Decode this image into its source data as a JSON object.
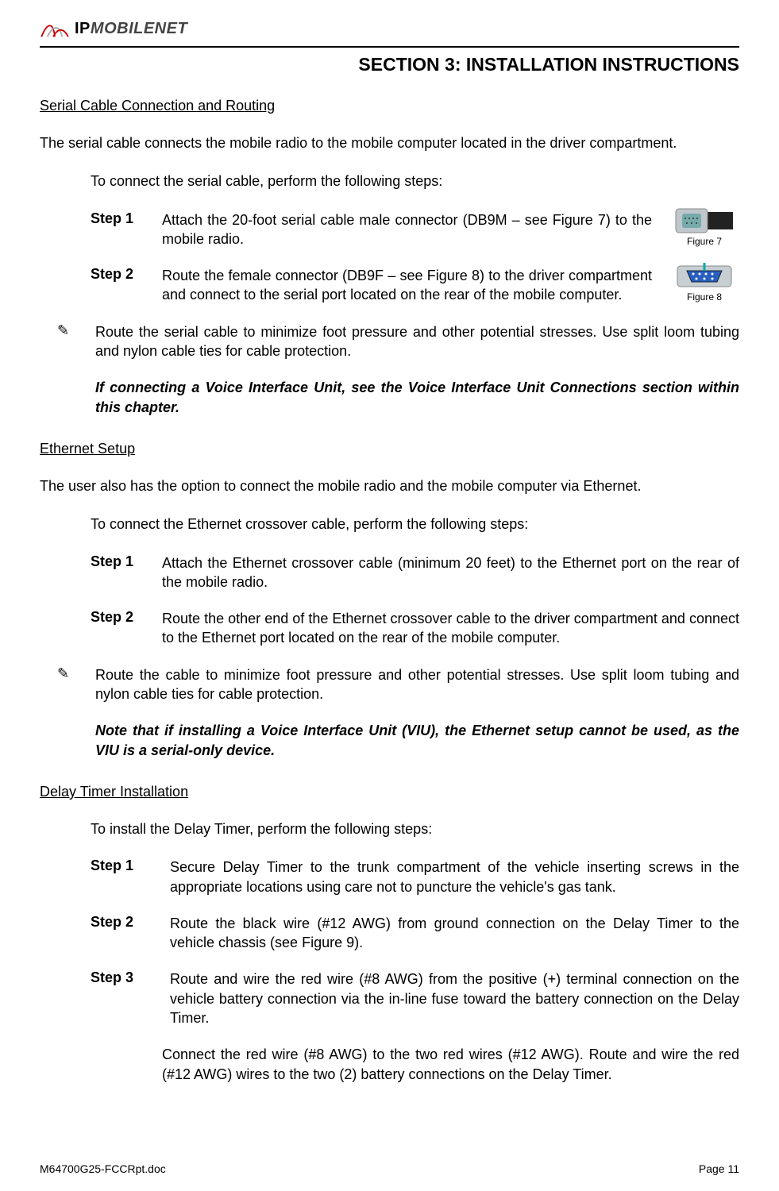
{
  "logo": {
    "brand_ip": "IP",
    "brand_rest": "MOBILENET"
  },
  "section_header": "SECTION 3: INSTALLATION INSTRUCTIONS",
  "serial": {
    "heading": "Serial Cable Connection and Routing",
    "intro": "The serial cable connects the mobile radio to the mobile computer located in the driver compartment.",
    "lead": "To connect the serial cable, perform the following steps:",
    "step1_label": "Step 1",
    "step1_text": "Attach the 20-foot serial cable male connector (DB9M – see Figure 7) to the mobile radio.",
    "step2_label": "Step 2",
    "step2_text": "Route the female connector (DB9F – see Figure 8) to the driver compartment and connect to the serial port located on the rear of the mobile computer.",
    "note_icon": "✎",
    "note_text": "Route the serial cable to minimize foot pressure and other potential stresses.  Use split loom tubing and nylon cable ties for cable protection.",
    "emphasis": "If connecting a Voice Interface Unit, see the Voice Interface Unit Connections section within this chapter.",
    "figure7_label": "Figure 7",
    "figure8_label": "Figure 8"
  },
  "ethernet": {
    "heading": "Ethernet Setup",
    "intro": "The user also has the option to connect the mobile radio and the mobile computer via Ethernet.",
    "lead": "To connect the Ethernet crossover cable, perform the following steps:",
    "step1_label": "Step 1",
    "step1_text": "Attach the Ethernet crossover cable (minimum 20 feet) to the Ethernet port on the rear of the mobile radio.",
    "step2_label": "Step 2",
    "step2_text": "Route the other end of the Ethernet crossover cable to the driver compartment and connect to the Ethernet port located on the rear of the mobile computer.",
    "note_icon": "✎",
    "note_text": "Route the cable to minimize foot pressure and other potential stresses.  Use split loom tubing and nylon cable ties for cable protection.",
    "emphasis": "Note that if installing a Voice Interface Unit (VIU), the Ethernet setup cannot be used, as the VIU is a serial-only device."
  },
  "delay": {
    "heading": "Delay Timer Installation",
    "lead": "To install the Delay Timer, perform the following steps:",
    "step1_label": "Step 1",
    "step1_text": "Secure Delay Timer to the trunk compartment of the vehicle inserting screws in the appropriate locations using care not to puncture the vehicle's gas tank.",
    "step2_label": "Step 2",
    "step2_text": "Route the black wire (#12 AWG) from ground connection on the Delay Timer to the vehicle chassis (see Figure 9).",
    "step3_label": "Step 3",
    "step3_text": "Route and wire the red wire (#8 AWG) from the positive (+) terminal connection on the vehicle battery connection via the in-line fuse toward the battery connection on the Delay Timer.",
    "step3_cont": "Connect the red wire (#8 AWG) to the two red wires (#12 AWG).  Route and wire the red (#12 AWG) wires to the two (2) battery connections on the Delay Timer."
  },
  "footer": {
    "left": "M64700G25-FCCRpt.doc",
    "right": "Page 11"
  }
}
